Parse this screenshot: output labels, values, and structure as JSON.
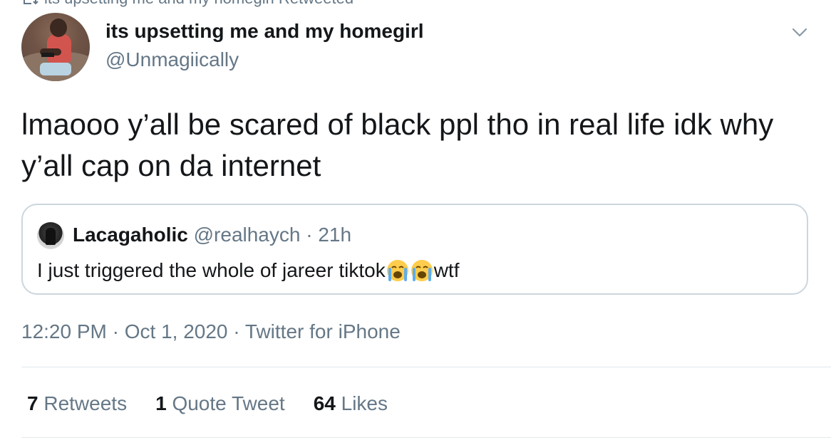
{
  "context": {
    "text": "its upsetting me and my homegirl Retweeted",
    "icon": "retweet-icon"
  },
  "author": {
    "display_name": "its upsetting me and my homegirl",
    "handle": "@Unmagiically",
    "avatar": "profile-photo"
  },
  "menu": {
    "icon": "chevron-down-icon"
  },
  "tweet": {
    "text": "lmaooo y’all be scared of black ppl tho in real life idk why y’all cap on da internet"
  },
  "quoted": {
    "display_name": "Lacagaholic",
    "handle": "@realhaych",
    "separator": "·",
    "age": "21h",
    "text_before": "I just triggered the whole of jareer tiktok",
    "emoji": [
      "loudly-crying-face",
      "loudly-crying-face"
    ],
    "text_after": "wtf"
  },
  "meta": {
    "time": "12:20 PM",
    "sep1": "·",
    "date": "Oct 1, 2020",
    "sep2": "·",
    "source": "Twitter for iPhone"
  },
  "stats": {
    "retweets": {
      "count": "7",
      "label": "Retweets"
    },
    "quotes": {
      "count": "1",
      "label": "Quote Tweet"
    },
    "likes": {
      "count": "64",
      "label": "Likes"
    }
  },
  "colors": {
    "text_primary": "#14171a",
    "text_secondary": "#657786",
    "border": "#ccd6dd",
    "divider": "#e1e8ed"
  }
}
